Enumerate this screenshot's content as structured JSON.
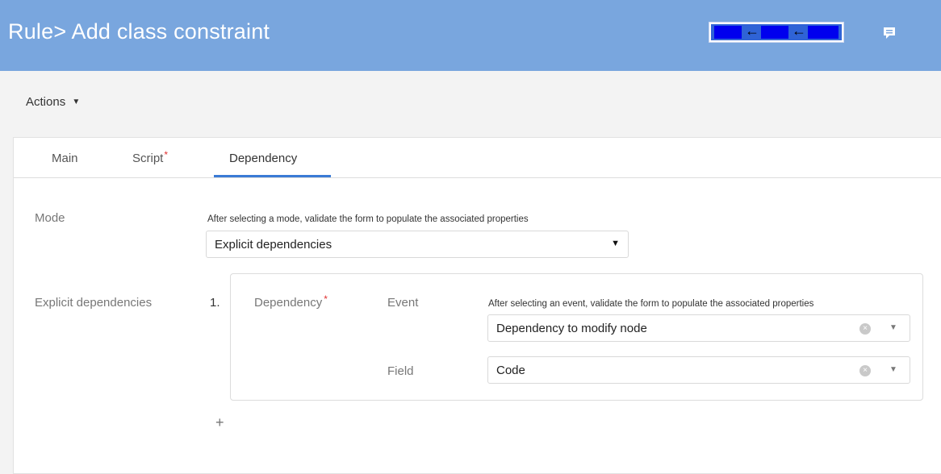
{
  "header": {
    "title": "Rule> Add class constraint",
    "flow_arrows": [
      "←",
      "←"
    ],
    "chat_icon": "comment-icon"
  },
  "toolbar": {
    "actions_label": "Actions",
    "actions_caret": "▼"
  },
  "tabs": [
    {
      "label": "Main",
      "required": ""
    },
    {
      "label": "Script",
      "required": "*"
    },
    {
      "label": "Dependency",
      "required": ""
    }
  ],
  "form": {
    "mode": {
      "label": "Mode",
      "hint": "After selecting a mode, validate the form to populate the associated properties",
      "value": "Explicit dependencies",
      "caret": "▼"
    },
    "explicit": {
      "label": "Explicit dependencies",
      "items": [
        {
          "number": "1.",
          "dependency_label": "Dependency",
          "required": "*",
          "event": {
            "label": "Event",
            "hint": "After selecting an event, validate the form to populate the associated properties",
            "value": "Dependency to modify node",
            "clear": "×",
            "caret": "▼"
          },
          "field": {
            "label": "Field",
            "value": "Code",
            "clear": "×",
            "caret": "▼"
          }
        }
      ],
      "add": "+"
    }
  },
  "colors": {
    "header_bg": "#79a6de",
    "accent": "#3a7bd5",
    "required": "#e03131"
  }
}
